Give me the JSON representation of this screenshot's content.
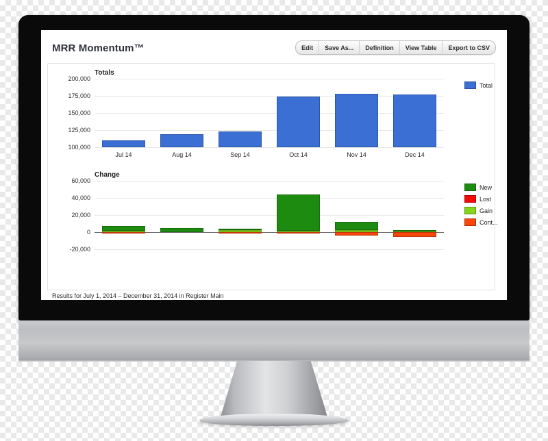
{
  "window": {
    "title": "MRR Momentum™",
    "toolbar_buttons": [
      "Edit",
      "Save As...",
      "Definition",
      "View Table",
      "Export to CSV"
    ],
    "footer_note": "Results for July 1, 2014 – December 31, 2014 in Register Main"
  },
  "colors": {
    "total": "#3b6fd4",
    "new": "#1d8b10",
    "lost": "#f60a06",
    "gain": "#86d51b",
    "contraction": "#f7470c",
    "gridline": "#e8e8e8",
    "zeroline": "#6f6f6f",
    "bezel": "#0a0a0a"
  },
  "chart_data": [
    {
      "type": "bar",
      "title": "Totals",
      "xlabel": "",
      "ylabel": "",
      "categories": [
        "Jul 14",
        "Aug 14",
        "Sep 14",
        "Oct 14",
        "Nov 14",
        "Dec 14"
      ],
      "yticks": [
        100000,
        125000,
        150000,
        175000,
        200000
      ],
      "ytick_labels": [
        "100,000",
        "125,000",
        "150,000",
        "175,000",
        "200,000"
      ],
      "ylim": [
        100000,
        200000
      ],
      "grid": true,
      "legend_position": "right",
      "series": [
        {
          "name": "Total",
          "color": "#3b6fd4",
          "values": [
            110000,
            119000,
            123000,
            174000,
            178500,
            177500
          ]
        }
      ]
    },
    {
      "type": "bar",
      "title": "Change",
      "xlabel": "",
      "ylabel": "",
      "categories": [
        "Jul 14",
        "Aug 14",
        "Sep 14",
        "Oct 14",
        "Nov 14",
        "Dec 14"
      ],
      "yticks": [
        -20000,
        0,
        20000,
        40000,
        60000
      ],
      "ytick_labels": [
        "-20,000",
        "0",
        "20,000",
        "40,000",
        "60,000"
      ],
      "ylim": [
        -20000,
        60000
      ],
      "grid": true,
      "stacked": true,
      "legend_position": "right",
      "series": [
        {
          "name": "New",
          "color": "#1d8b10",
          "values": [
            5600,
            5000,
            1600,
            42500,
            10000,
            1200
          ]
        },
        {
          "name": "Lost",
          "color": "#f60a06",
          "values": [
            0,
            0,
            0,
            0,
            0,
            0
          ]
        },
        {
          "name": "Gain",
          "color": "#86d51b",
          "values": [
            1800,
            0,
            2200,
            1300,
            2200,
            900
          ]
        },
        {
          "name": "Cont...",
          "color": "#f7470c",
          "values": [
            -400,
            0,
            -300,
            -500,
            -4200,
            -5200
          ]
        }
      ],
      "legend_entries": [
        "New",
        "Lost",
        "Gain",
        "Cont..."
      ]
    }
  ]
}
